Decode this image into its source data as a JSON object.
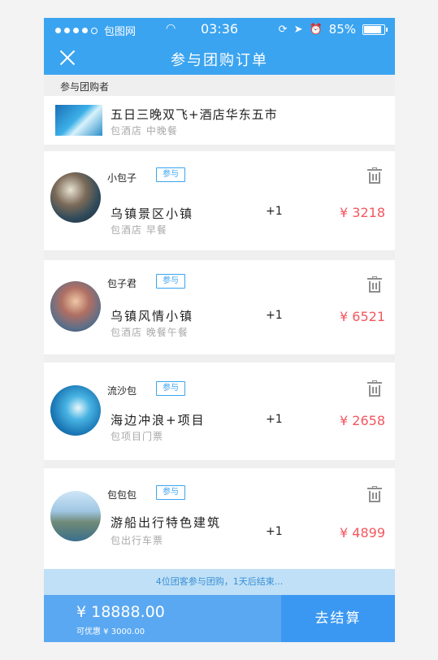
{
  "status_bar": {
    "carrier": "包图网",
    "time": "03:36",
    "battery": "85%"
  },
  "nav": {
    "title": "参与团购订单"
  },
  "section_label": "参与团购者",
  "lead": {
    "title": "五日三晚双飞+酒店华东五市",
    "subtitle": "包酒店 中晚餐"
  },
  "members": [
    {
      "name": "小包子",
      "badge": "参与",
      "product": "乌镇景区小镇",
      "detail": "包酒店 早餐",
      "qty": "+1",
      "price": "¥ 3218"
    },
    {
      "name": "包子君",
      "badge": "参与",
      "product": "乌镇风情小镇",
      "detail": "包酒店 晚餐午餐",
      "qty": "+1",
      "price": "¥ 6521"
    },
    {
      "name": "流沙包",
      "badge": "参与",
      "product": "海边冲浪+项目",
      "detail": "包项目门票",
      "qty": "+1",
      "price": "¥ 2658"
    },
    {
      "name": "包包包",
      "badge": "参与",
      "product": "游船出行特色建筑",
      "detail": "包出行车票",
      "qty": "+1",
      "price": "¥ 4899"
    }
  ],
  "notice": "4位团客参与团购，1天后结束...",
  "footer": {
    "total": "¥ 18888.00",
    "discount": "可优惠 ¥ 3000.00",
    "checkout_label": "去结算"
  }
}
